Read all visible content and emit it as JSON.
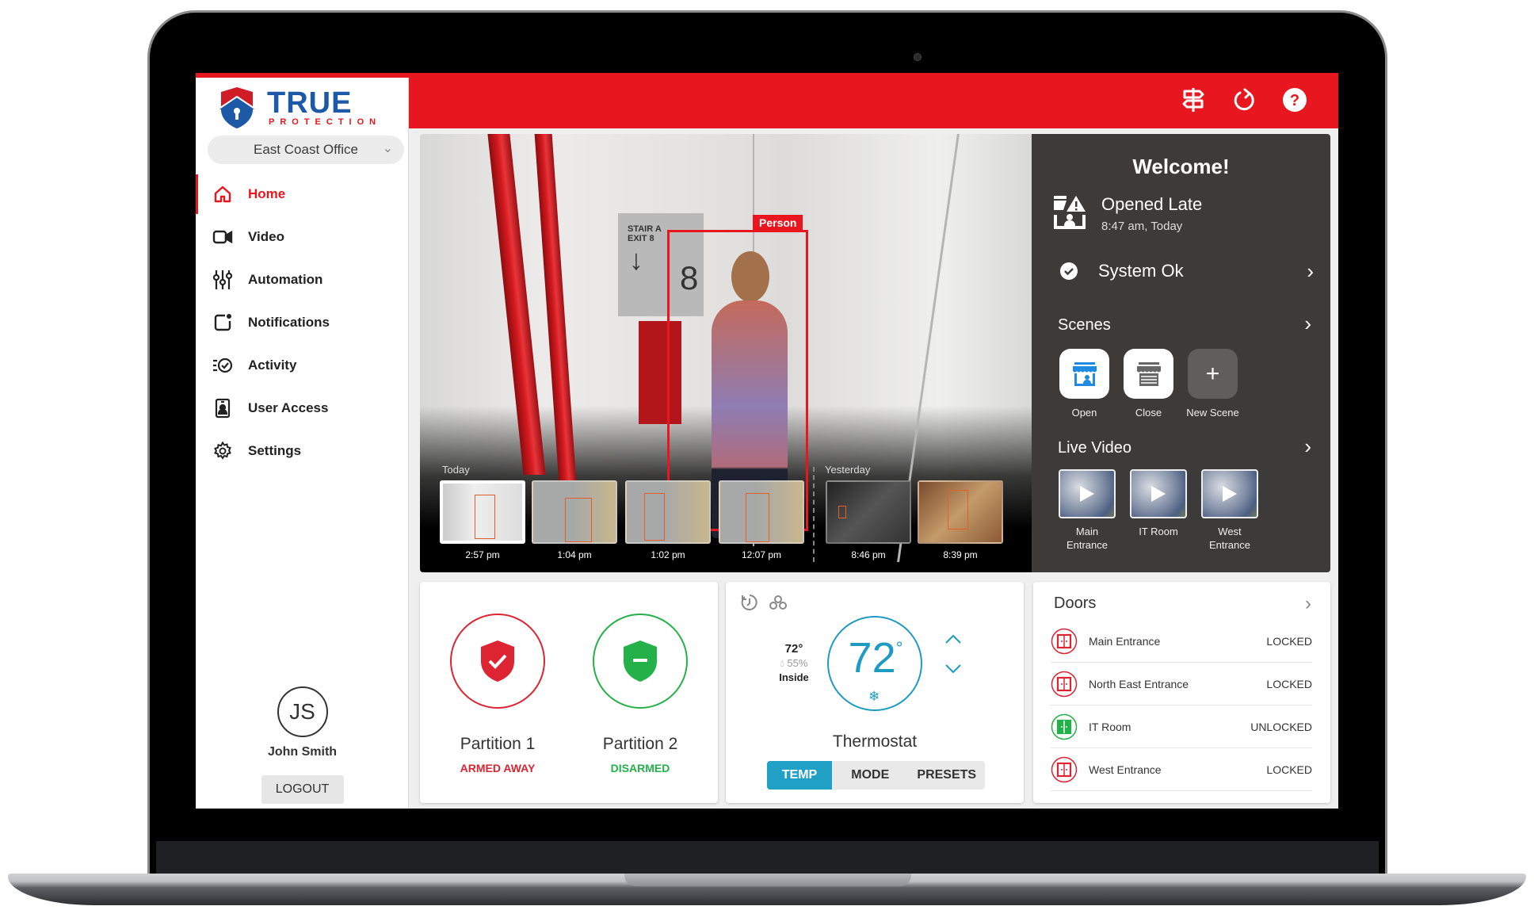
{
  "brand": {
    "name": "TRUE",
    "tagline": "PROTECTION"
  },
  "site_selector": {
    "value": "East Coast Office"
  },
  "topbar": {
    "icons": [
      "signpost-icon",
      "refresh-icon",
      "help-icon"
    ]
  },
  "sidebar": {
    "items": [
      {
        "label": "Home",
        "icon": "home-icon",
        "active": true
      },
      {
        "label": "Video",
        "icon": "video-camera-icon"
      },
      {
        "label": "Automation",
        "icon": "sliders-icon"
      },
      {
        "label": "Notifications",
        "icon": "notification-icon"
      },
      {
        "label": "Activity",
        "icon": "activity-icon"
      },
      {
        "label": "User Access",
        "icon": "badge-icon"
      },
      {
        "label": "Settings",
        "icon": "gear-icon"
      }
    ]
  },
  "user": {
    "initials": "JS",
    "name": "John Smith",
    "logout_label": "LOGOUT"
  },
  "video": {
    "detection_label": "Person",
    "today_label": "Today",
    "yesterday_label": "Yesterday",
    "clips": [
      {
        "time": "2:57 pm",
        "day": "Today",
        "selected": true
      },
      {
        "time": "1:04 pm",
        "day": "Today"
      },
      {
        "time": "1:02 pm",
        "day": "Today"
      },
      {
        "time": "12:07 pm",
        "day": "Today"
      },
      {
        "time": "8:46 pm",
        "day": "Yesterday"
      },
      {
        "time": "8:39 pm",
        "day": "Yesterday"
      }
    ]
  },
  "panel": {
    "welcome": "Welcome!",
    "event": {
      "title": "Opened Late",
      "time": "8:47 am, Today"
    },
    "system_status": "System Ok",
    "scenes_title": "Scenes",
    "scenes": [
      {
        "label": "Open",
        "icon": "storefront-open-icon"
      },
      {
        "label": "Close",
        "icon": "storefront-closed-icon"
      },
      {
        "label": "New Scene",
        "icon": "plus-icon"
      }
    ],
    "live_title": "Live Video",
    "live": [
      {
        "label": "Main Entrance"
      },
      {
        "label": "IT Room"
      },
      {
        "label": "West Entrance"
      }
    ]
  },
  "partitions": [
    {
      "name": "Partition 1",
      "state": "ARMED AWAY",
      "color": "#dc2432"
    },
    {
      "name": "Partition 2",
      "state": "DISARMED",
      "color": "#24b14a"
    }
  ],
  "thermostat": {
    "name": "Thermostat",
    "setpoint": "72",
    "inside_temp": "72°",
    "humidity": "55%",
    "inside_label": "Inside",
    "tabs": [
      "TEMP",
      "MODE",
      "PRESETS"
    ],
    "active_tab": "TEMP",
    "accent": "#1d9bc2"
  },
  "doors": {
    "title": "Doors",
    "items": [
      {
        "name": "Main Entrance",
        "state": "LOCKED",
        "color": "#dc2432"
      },
      {
        "name": "North East Entrance",
        "state": "LOCKED",
        "color": "#dc2432"
      },
      {
        "name": "IT Room",
        "state": "UNLOCKED",
        "color": "#24b14a"
      },
      {
        "name": "West Entrance",
        "state": "LOCKED",
        "color": "#dc2432"
      }
    ]
  },
  "colors": {
    "brand_red": "#e8171f",
    "brand_blue": "#1c5aa8",
    "panel_bg": "#3c3b39"
  }
}
